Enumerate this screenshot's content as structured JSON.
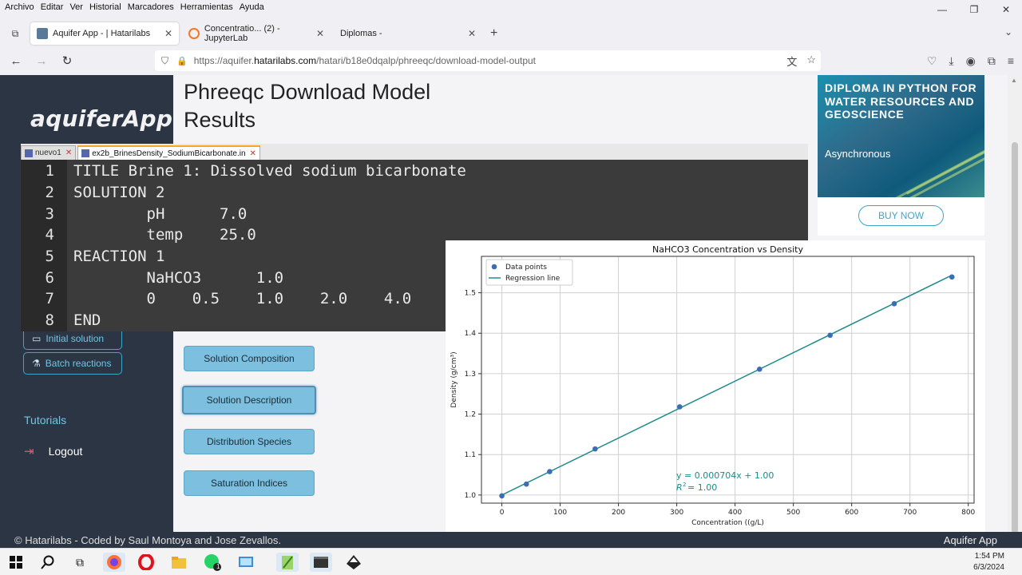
{
  "menubar": {
    "items": [
      "Archivo",
      "Editar",
      "Ver",
      "Historial",
      "Marcadores",
      "Herramientas",
      "Ayuda"
    ]
  },
  "window_controls": {
    "minimize": "—",
    "restore": "❐",
    "close": "✕"
  },
  "tabs": [
    {
      "label": "Aquifer App - | Hatarilabs",
      "favicon_color": "#5a7a99",
      "active": true
    },
    {
      "label": "Concentratio... (2) - JupyterLab",
      "favicon_color": "#f37726",
      "active": false
    },
    {
      "label": "Diplomas -",
      "favicon_color": "#ffffff",
      "active": false
    }
  ],
  "tab_close_glyph": "✕",
  "newtab_glyph": "+",
  "tab_overflow_glyph": "⌄",
  "tab_list_glyph": "⧉",
  "nav": {
    "back": "←",
    "forward": "→",
    "reload": "↻"
  },
  "url": {
    "prefix": "https://aquifer.",
    "host": "hatarilabs.com",
    "path": "/hatari/b18e0dqalp/phreeqc/download-model-output"
  },
  "url_icons": {
    "shield": "⛉",
    "lock": "🔒",
    "translate": "文",
    "bookmark": "☆"
  },
  "toolbar_icons": {
    "pocket": "♡",
    "downloads": "⤓",
    "account": "◉",
    "extensions": "⧉",
    "menu": "≡"
  },
  "sidebar": {
    "logo": "aquiferApp",
    "buttons": [
      {
        "label": "Initial solution",
        "icon": "▭"
      },
      {
        "label": "Batch reactions",
        "icon": "⚗"
      }
    ],
    "tutorials": "Tutorials",
    "logout": "Logout",
    "logout_icon": "⇥"
  },
  "main": {
    "title": "Phreeqc Download Model Results",
    "result_buttons": [
      {
        "label": "Solution Composition"
      },
      {
        "label": "Solution Description"
      },
      {
        "label": "Distribution Species"
      },
      {
        "label": "Saturation Indices"
      }
    ]
  },
  "ad": {
    "title": "DIPLOMA IN PYTHON FOR WATER RESOURCES AND GEOSCIENCE",
    "subtitle": "Asynchronous",
    "button": "BUY NOW"
  },
  "npp": {
    "tabs": [
      "nuevo1",
      "ex2b_BrinesDensity_SodiumBicarbonate.in"
    ],
    "tab_close": "✕",
    "lines": [
      {
        "n": "1",
        "text": "TITLE Brine 1: Dissolved sodium bicarbonate"
      },
      {
        "n": "2",
        "text": "SOLUTION 2"
      },
      {
        "n": "3",
        "text": "        pH      7.0"
      },
      {
        "n": "4",
        "text": "        temp    25.0"
      },
      {
        "n": "5",
        "text": "REACTION 1"
      },
      {
        "n": "6",
        "text": "        NaHCO3      1.0"
      },
      {
        "n": "7",
        "text": "        0    0.5    1.0    2.0    4.0"
      },
      {
        "n": "8",
        "text": "END"
      }
    ]
  },
  "chart_data": {
    "type": "scatter",
    "title": "NaHCO3 Concentration vs Density",
    "xlabel": "Concentration ((g/L)",
    "ylabel": "Density (g/cm³)",
    "xlim": [
      -35,
      810
    ],
    "ylim": [
      0.98,
      1.59
    ],
    "xticks": [
      0,
      100,
      200,
      300,
      400,
      500,
      600,
      700,
      800
    ],
    "yticks": [
      1.0,
      1.1,
      1.2,
      1.3,
      1.4,
      1.5
    ],
    "grid": true,
    "legend_position": "top-left",
    "series": [
      {
        "name": "Data points",
        "kind": "scatter",
        "color": "#3a6db5",
        "x": [
          0,
          42,
          82,
          160,
          305,
          442,
          563,
          673,
          772
        ],
        "y": [
          0.998,
          1.027,
          1.058,
          1.114,
          1.218,
          1.311,
          1.395,
          1.473,
          1.539
        ]
      },
      {
        "name": "Regression line",
        "kind": "line",
        "color": "#1f8a8a",
        "x": [
          0,
          772
        ],
        "y": [
          1.0,
          1.5435
        ]
      }
    ],
    "annotation": {
      "equation": "y = 0.000704x + 1.00",
      "r2_label": "R",
      "r2_value": " = 1.00"
    }
  },
  "footer": {
    "copyright": "© Hatarilabs - Coded by Saul Montoya and Jose Zevallos.",
    "app_name": "Aquifer App"
  },
  "taskbar": {
    "icons": [
      "windows-icon",
      "search-icon",
      "task-view-icon",
      "firefox-icon",
      "opera-icon",
      "file-explorer-icon",
      "whatsapp-icon",
      "remote-desktop-icon",
      "notepadpp-icon",
      "terminal-icon",
      "inkscape-icon"
    ],
    "time": "1:54 PM",
    "date": "6/3/2024",
    "whatsapp_badge": "1"
  }
}
